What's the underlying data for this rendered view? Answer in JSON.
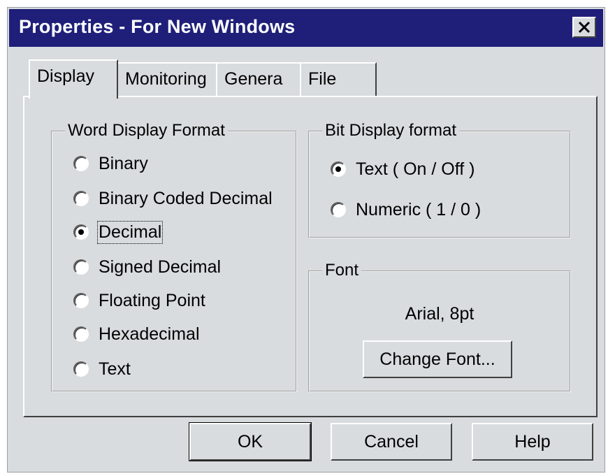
{
  "window": {
    "title": "Properties - For New Windows",
    "close_symbol": "close-icon"
  },
  "tabs": [
    {
      "label": "Display",
      "active": true
    },
    {
      "label": "Monitoring",
      "active": false
    },
    {
      "label": "Genera",
      "active": false
    },
    {
      "label": "File",
      "active": false
    }
  ],
  "word_display_format": {
    "legend": "Word Display Format",
    "options": [
      {
        "label": "Binary",
        "checked": false
      },
      {
        "label": "Binary Coded Decimal",
        "checked": false
      },
      {
        "label": "Decimal",
        "checked": true
      },
      {
        "label": "Signed Decimal",
        "checked": false
      },
      {
        "label": "Floating Point",
        "checked": false
      },
      {
        "label": "Hexadecimal",
        "checked": false
      },
      {
        "label": "Text",
        "checked": false
      }
    ]
  },
  "bit_display_format": {
    "legend": "Bit Display format",
    "options": [
      {
        "label": "Text ( On / Off )",
        "checked": true
      },
      {
        "label": "Numeric ( 1 / 0 )",
        "checked": false
      }
    ]
  },
  "font": {
    "legend": "Font",
    "value": "Arial, 8pt",
    "change_button": "Change Font..."
  },
  "buttons": {
    "ok": "OK",
    "cancel": "Cancel",
    "help": "Help"
  }
}
